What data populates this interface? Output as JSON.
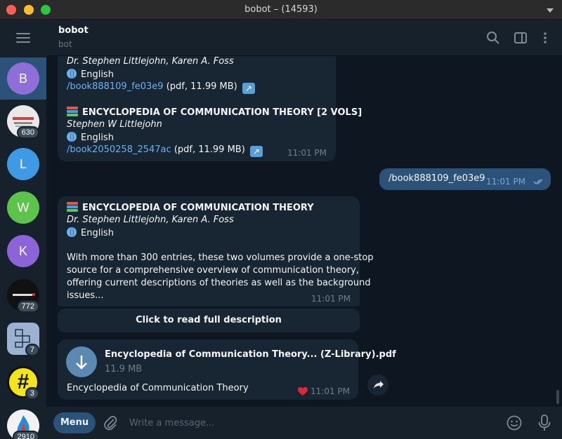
{
  "window": {
    "title": "bobot – (14593)"
  },
  "sidebar": {
    "chats": [
      {
        "letter": "B",
        "color": "#8e6fd8",
        "badge": ""
      },
      {
        "letter": "",
        "color": "#e9e9e9",
        "badge": "630"
      },
      {
        "letter": "L",
        "color": "#3f9ae6",
        "badge": ""
      },
      {
        "letter": "W",
        "color": "#5cc34b",
        "badge": ""
      },
      {
        "letter": "K",
        "color": "#8d63d8",
        "badge": ""
      },
      {
        "letter": "",
        "color": "#111111",
        "badge": "772"
      },
      {
        "letter": "",
        "color": "#9bb3d1",
        "badge": "7"
      },
      {
        "letter": "#",
        "color": "#f4e51a",
        "badge": "3"
      },
      {
        "letter": "",
        "color": "#f2f2f2",
        "badge": "2910"
      }
    ]
  },
  "header": {
    "name": "bobot",
    "status": "bot"
  },
  "messages": {
    "m1": {
      "author_partial": "Dr. Stephen Littlejohn, Karen A. Foss",
      "lang1": "English",
      "link1": "/book888109_fe03e9",
      "meta1": "(pdf, 11.99 MB)",
      "title2": "ENCYCLOPEDIA OF COMMUNICATION THEORY  [2 VOLS]",
      "author2": "Stephen W Littlejohn",
      "lang2": "English",
      "link2": "/book2050258_2547ac",
      "meta2": "(pdf, 11.99 MB)",
      "time": "11:01 PM"
    },
    "out1": {
      "text": "/book888109_fe03e9",
      "time": "11:01 PM"
    },
    "m2": {
      "title": "ENCYCLOPEDIA OF COMMUNICATION THEORY",
      "author": "Dr. Stephen Littlejohn, Karen A. Foss",
      "lang": "English",
      "desc": [
        "With more than 300 entries, these two volumes provide a one-stop",
        "source for a comprehensive overview of communication theory,",
        "offering current descriptions of theories as well as the background",
        "issues..."
      ],
      "time": "11:01 PM",
      "button": "Click to read full description"
    },
    "m3": {
      "file_name": "Encyclopedia of Communication Theory... (Z-Library).pdf",
      "file_size": "11.9 MB",
      "caption": "Encyclopedia of Communication Theory",
      "time": "11:01 PM"
    }
  },
  "composer": {
    "menu": "Menu",
    "placeholder": "Write a message..."
  }
}
